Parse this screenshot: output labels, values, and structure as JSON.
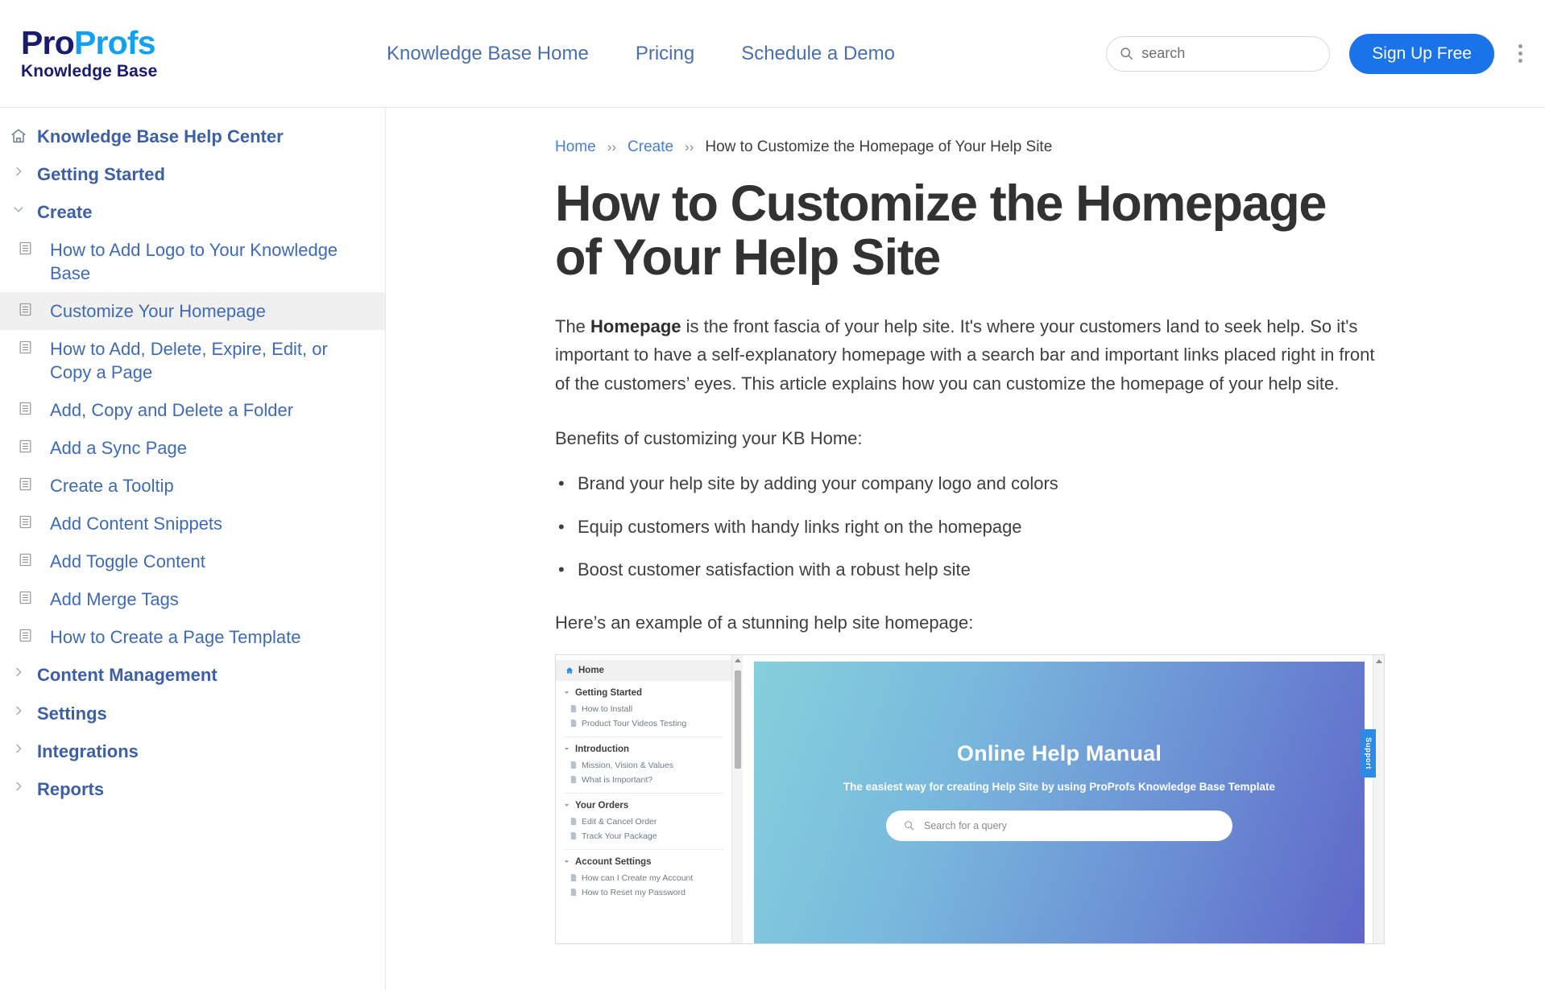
{
  "header": {
    "logo": {
      "part1": "Pro",
      "part2": "Profs",
      "sub": "Knowledge Base"
    },
    "nav": [
      {
        "label": "Knowledge Base Home"
      },
      {
        "label": "Pricing"
      },
      {
        "label": "Schedule a Demo"
      }
    ],
    "search": {
      "placeholder": "search",
      "value": "",
      "icon": "search-icon"
    },
    "signup_label": "Sign Up Free",
    "menu_icon": "kebab-menu-icon"
  },
  "sidebar": {
    "home": {
      "label": "Knowledge Base Help Center",
      "icon": "home-icon"
    },
    "items": [
      {
        "label": "Getting Started",
        "type": "group",
        "expanded": false
      },
      {
        "label": "Create",
        "type": "group",
        "expanded": true
      },
      {
        "label": "How to Add Logo to Your Knowledge Base",
        "type": "page"
      },
      {
        "label": "Customize Your Homepage",
        "type": "page",
        "selected": true
      },
      {
        "label": "How to Add, Delete, Expire, Edit, or Copy a Page",
        "type": "page"
      },
      {
        "label": "Add, Copy and Delete a Folder",
        "type": "page"
      },
      {
        "label": "Add a Sync Page",
        "type": "page"
      },
      {
        "label": "Create a Tooltip",
        "type": "page"
      },
      {
        "label": "Add Content Snippets",
        "type": "page"
      },
      {
        "label": "Add Toggle Content",
        "type": "page"
      },
      {
        "label": "Add Merge Tags",
        "type": "page"
      },
      {
        "label": "How to Create a Page Template",
        "type": "page"
      },
      {
        "label": "Content Management",
        "type": "group",
        "expanded": false
      },
      {
        "label": "Settings",
        "type": "group",
        "expanded": false
      },
      {
        "label": "Integrations",
        "type": "group",
        "expanded": false
      },
      {
        "label": "Reports",
        "type": "group",
        "expanded": false
      }
    ]
  },
  "breadcrumb": {
    "home": "Home",
    "section": "Create",
    "current": "How to Customize the Homepage of Your Help Site",
    "separator": "››"
  },
  "article": {
    "title": "How to Customize the Homepage of Your Help Site",
    "intro_pre": "The ",
    "intro_bold": "Homepage",
    "intro_post": " is the front fascia of your help site. It's where your customers land to seek help. So it's important to have a self-explanatory homepage with a search bar and important links placed right in front of the customers’ eyes. This article explains how you can customize the homepage of your help site.",
    "benefits_heading": "Benefits of customizing your KB Home:",
    "benefits": [
      "Brand your help site by adding your company logo and colors",
      "Equip customers with handy links right on the homepage",
      "Boost customer satisfaction with a robust help site"
    ],
    "example_caption": "Here’s an example of a stunning help site homepage:"
  },
  "demo": {
    "home_label": "Home",
    "home_icon": "home-icon",
    "groups": [
      {
        "title": "Getting Started",
        "pages": [
          "How to Install",
          "Product Tour Videos Testing"
        ]
      },
      {
        "title": "Introduction",
        "pages": [
          "Mission, Vision & Values",
          "What is Important?"
        ]
      },
      {
        "title": "Your Orders",
        "pages": [
          "Edit & Cancel Order",
          "Track Your Package"
        ]
      },
      {
        "title": "Account Settings",
        "pages": [
          "How can I Create my Account",
          "How to Reset my Password"
        ]
      }
    ],
    "hero": {
      "title": "Online Help Manual",
      "subtitle": "The easiest way for creating Help Site by using ProProfs Knowledge Base Template",
      "search_placeholder": "Search for a query",
      "search_icon": "search-icon",
      "gradient_from": "#85d0dc",
      "gradient_to": "#5f67c8"
    },
    "support_tab": "Support"
  },
  "colors": {
    "accent_blue": "#1a73e8",
    "link_blue": "#4a6fae",
    "logo_navy": "#1a1a6e",
    "logo_cyan": "#12a1f0"
  }
}
